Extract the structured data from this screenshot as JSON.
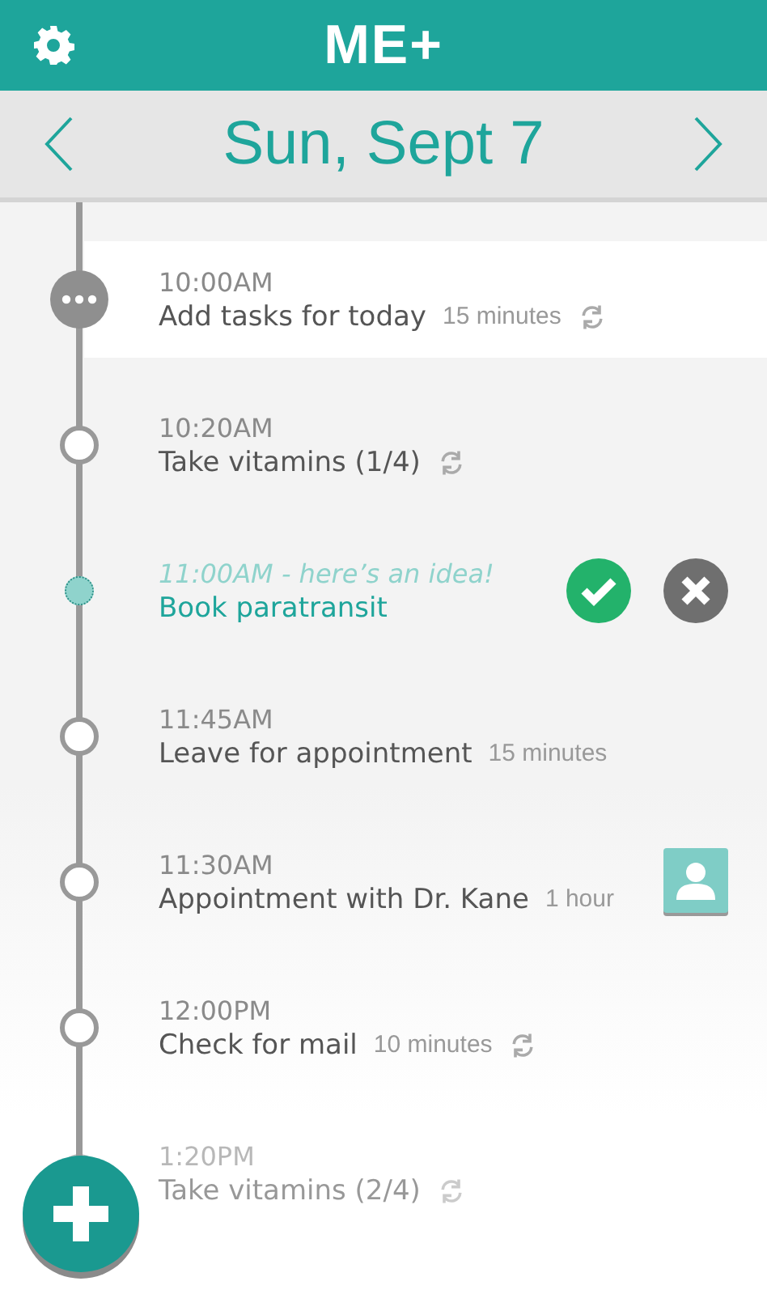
{
  "header": {
    "title": "ME+"
  },
  "date_bar": {
    "date": "Sun, Sept 7"
  },
  "tasks": [
    {
      "kind": "current",
      "time": "10:00AM",
      "title": "Add tasks for today",
      "duration": "15 minutes",
      "repeat": true,
      "contact": false,
      "faded": false
    },
    {
      "kind": "normal",
      "time": "10:20AM",
      "title": "Take vitamins (1/4)",
      "repeat": true,
      "contact": false,
      "faded": false
    },
    {
      "kind": "suggestion",
      "time": "11:00AM - here’s an idea!",
      "title": "Book paratransit",
      "repeat": false,
      "contact": false,
      "faded": false
    },
    {
      "kind": "normal",
      "time": "11:45AM",
      "title": "Leave for appointment",
      "duration": "15 minutes",
      "repeat": false,
      "contact": false,
      "faded": false
    },
    {
      "kind": "normal",
      "time": "11:30AM",
      "title": "Appointment with Dr. Kane",
      "duration": "1 hour",
      "repeat": false,
      "contact": true,
      "faded": false
    },
    {
      "kind": "normal",
      "time": "12:00PM",
      "title": "Check for mail",
      "duration": "10 minutes",
      "repeat": true,
      "contact": false,
      "faded": false
    },
    {
      "kind": "normal",
      "time": "1:20PM",
      "title": "Take vitamins (2/4)",
      "repeat": true,
      "contact": false,
      "faded": true
    }
  ]
}
